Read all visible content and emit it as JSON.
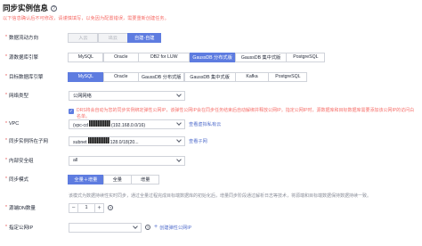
{
  "title": "同步实例信息",
  "hint": "以下信息确认后不可修改，请谨慎填写，以免因为配置错误，需要重新创建任务。",
  "fields": {
    "flow": {
      "label": "数据流动方向",
      "options": [
        "入云",
        "出云",
        "自建-自建"
      ],
      "selected": 2
    },
    "source_engine": {
      "label": "源数据库引擎",
      "options": [
        "MySQL",
        "Oracle",
        "DB2 for LUW",
        "GaussDB 分布式版",
        "GaussDB 集中式版",
        "PostgreSQL"
      ],
      "selected": 3
    },
    "target_engine": {
      "label": "目标数据库引擎",
      "options": [
        "MySQL",
        "Oracle",
        "GaussDB 分布式版",
        "GaussDB 集中式版",
        "Kafka",
        "PostgreSQL"
      ],
      "selected": 0
    },
    "network": {
      "label": "网络类型",
      "value": "公网网络",
      "checkbox_text": "DRS将会自动为您的同步实例绑定弹性公网IP，该弹性公网IP会在同步任务结束后自动解绑并释放公网IP。指定公网IP时，源数据库和目标数据库需要添加该公网IP的访问白名单。"
    },
    "vpc": {
      "label": "VPC",
      "value_prefix": "(vpc-cd",
      "value_suffix": "(192.168.0.0/16)",
      "link": "查看虚拟私有云"
    },
    "subnet": {
      "label": "同步实例所在子网",
      "value_prefix": "subnet",
      "value_suffix": "128.0/18(20...",
      "link": "查看子网"
    },
    "security_group": {
      "label": "内部安全组",
      "value": "all"
    },
    "sync_mode": {
      "label": "同步模式",
      "options": [
        "全量＋增量",
        "全量",
        "增量"
      ],
      "selected": 0,
      "note": "该模式为数据持续性实时同步，通过全量过程完成目标端数据库的初始化后，增量同步阶段通过解析日志等技术，将源端和目标端数据保持数据持续一致。"
    },
    "dn_count": {
      "label": "源端DN数量",
      "value": "1",
      "minus": "−",
      "plus": "+"
    },
    "eip": {
      "label": "指定公网IP",
      "link": "创建弹性公网IP"
    }
  },
  "colors": {
    "primary": "#5e7ce0",
    "danger_text": "#f66f6a",
    "link": "#526ecc"
  }
}
